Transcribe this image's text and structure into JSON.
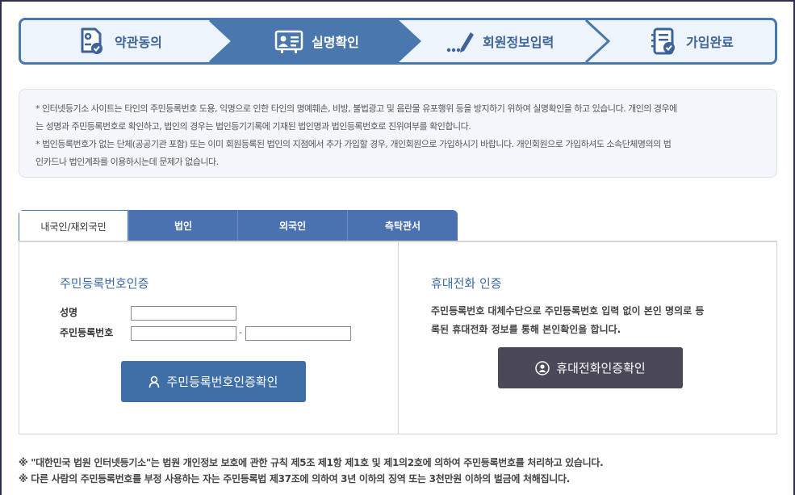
{
  "steps": [
    {
      "label": "약관동의",
      "icon": "document-check-icon"
    },
    {
      "label": "실명확인",
      "icon": "id-card-icon"
    },
    {
      "label": "회원정보입력",
      "icon": "pencil-icon"
    },
    {
      "label": "가입완료",
      "icon": "list-check-icon"
    }
  ],
  "notice": {
    "line1": "* 인터넷등기소 사이트는 타인의 주민등록번호 도용, 익명으로 인한 타인의 명예훼손, 비방, 불법광고 및 음란물 유포행위 등을 방지하기 위하여 실명확인을 하고 있습니다. 개인의 경우에",
    "line2": "는 성명과 주민등록번호로 확인하고, 법인의 경우는 법인등기기록에 기재된 법인명과 법인등록번호로 진위여부를 확인합니다.",
    "line3": "* 법인등록번호가 없는 단체(공공기관 포함) 또는 이미 회원등록된 법인의 지점에서 추가 가입할 경우, 개인회원으로 가입하시기 바랍니다. 개인회원으로 가입하셔도 소속단체명의의 법",
    "line4": "인카드나 법인계좌를 이용하시는데 문제가 없습니다."
  },
  "tabs": [
    {
      "label": "내국인/재외국민",
      "active": true
    },
    {
      "label": "법인",
      "active": false
    },
    {
      "label": "외국인",
      "active": false
    },
    {
      "label": "측탁관서",
      "active": false
    }
  ],
  "left": {
    "title": "주민등록번호인증",
    "name_label": "성명",
    "rrn_label": "주민등록번호",
    "name_value": "",
    "rrn_front_value": "",
    "rrn_back_value": "",
    "dash": "-",
    "button_label": "주민등록번호인증확인"
  },
  "right": {
    "title": "휴대전화 인증",
    "desc_line1": "주민등록번호 대체수단으로 주민등록번호 입력 없이 본인 명의로 등",
    "desc_line2": "록된 휴대전화 정보를 통해 본인확인을 합니다.",
    "button_label": "휴대전화인증확인"
  },
  "footnotes": {
    "line1": "※ \"대한민국 법원 인터넷등기소\"는 법원 개인정보 보호에 관한 규칙 제5조 제1항 제1호 및 제1의2호에 의하여 주민등록번호를 처리하고 있습니다.",
    "line2": "※ 다른 사람의 주민등록번호를 부정 사용하는 자는 주민등록법 제37조에 의하여 3년 이하의 징역 또는 3천만원 이하의 벌금에 처해집니다."
  },
  "colors": {
    "accent": "#4a77ae",
    "active_step": "#4a77ae",
    "tab": "#4a71b0",
    "primary_button": "#3f6fa7",
    "dark_button": "#4b4858"
  }
}
